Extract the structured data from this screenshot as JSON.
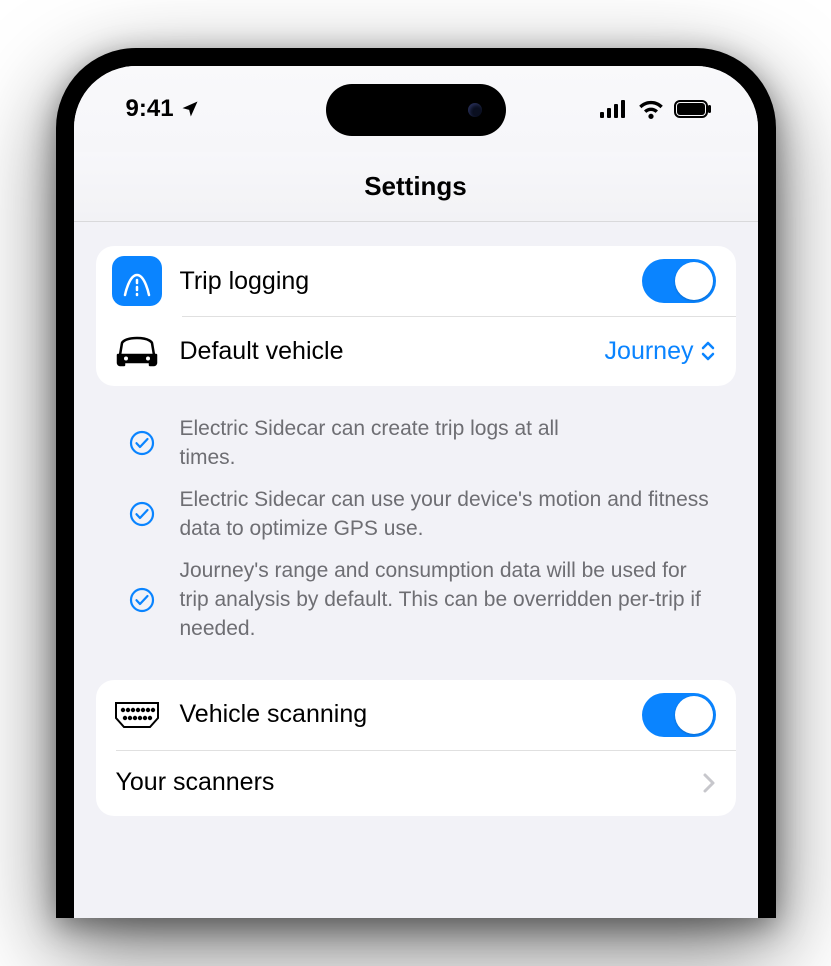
{
  "statusBar": {
    "time": "9:41"
  },
  "navBar": {
    "title": "Settings"
  },
  "section1": {
    "tripLogging": {
      "label": "Trip logging",
      "on": true
    },
    "defaultVehicle": {
      "label": "Default vehicle",
      "value": "Journey"
    },
    "footer": {
      "items": [
        "Electric Sidecar can create trip logs at all times.",
        "Electric Sidecar can use your device's motion and fitness data to optimize GPS use.",
        "Journey's range and consumption data will be used for trip analysis by default. This can be overridden per-trip if needed."
      ]
    }
  },
  "section2": {
    "vehicleScanning": {
      "label": "Vehicle scanning",
      "on": true
    },
    "yourScanners": {
      "label": "Your scanners"
    }
  }
}
